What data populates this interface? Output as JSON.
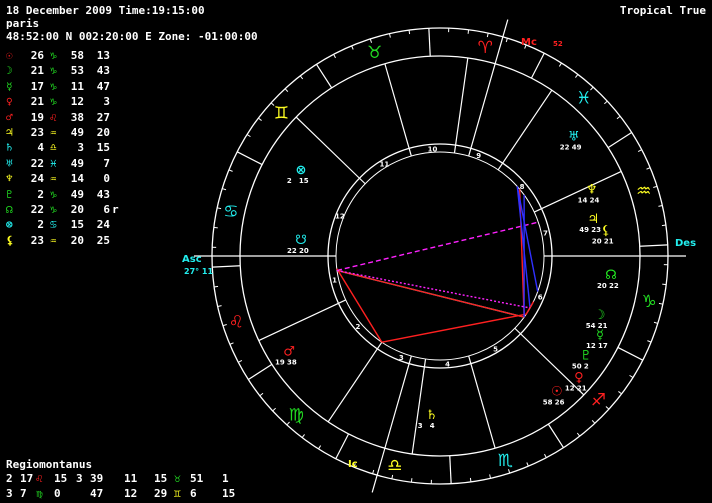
{
  "header": {
    "line1": "18 December 2009 Time:19:15:00",
    "line2": "paris",
    "line3": "48:52:00 N 002:20:00 E Zone: -01:00:00",
    "mode": "Tropical True"
  },
  "colors": {
    "fire": "#ff2020",
    "earth": "#22dd22",
    "air": "#ffff22",
    "water": "#22eeee",
    "node": "#22ee22",
    "magenta": "#ff22ff"
  },
  "planets": [
    {
      "glyph": "☉",
      "name": "sun-icon",
      "color": "#ff2020",
      "deg": "26",
      "sign": "♑",
      "scolor": "#22dd22",
      "min": "58",
      "sec": "13",
      "r": ""
    },
    {
      "glyph": "☽",
      "name": "moon-icon",
      "color": "#22dd22",
      "deg": "21",
      "sign": "♑",
      "scolor": "#22dd22",
      "min": "53",
      "sec": "43",
      "r": ""
    },
    {
      "glyph": "☿",
      "name": "mercury-icon",
      "color": "#22dd22",
      "deg": "17",
      "sign": "♑",
      "scolor": "#22dd22",
      "min": "11",
      "sec": "47",
      "r": ""
    },
    {
      "glyph": "♀",
      "name": "venus-icon",
      "color": "#ff2020",
      "deg": "21",
      "sign": "♑",
      "scolor": "#22dd22",
      "min": "12",
      "sec": "3",
      "r": ""
    },
    {
      "glyph": "♂",
      "name": "mars-icon",
      "color": "#ff2020",
      "deg": "19",
      "sign": "♌",
      "scolor": "#ff2020",
      "min": "38",
      "sec": "27",
      "r": ""
    },
    {
      "glyph": "♃",
      "name": "jupiter-icon",
      "color": "#ffff22",
      "deg": "23",
      "sign": "♒",
      "scolor": "#ffff22",
      "min": "49",
      "sec": "20",
      "r": ""
    },
    {
      "glyph": "♄",
      "name": "saturn-icon",
      "color": "#22eeee",
      "deg": "4",
      "sign": "♎",
      "scolor": "#ffff22",
      "min": "3",
      "sec": "15",
      "r": ""
    },
    {
      "glyph": "♅",
      "name": "uranus-icon",
      "color": "#22eeee",
      "deg": "22",
      "sign": "♓",
      "scolor": "#22eeee",
      "min": "49",
      "sec": "7",
      "r": ""
    },
    {
      "glyph": "♆",
      "name": "neptune-icon",
      "color": "#ffff22",
      "deg": "24",
      "sign": "♒",
      "scolor": "#ffff22",
      "min": "14",
      "sec": "0",
      "r": ""
    },
    {
      "glyph": "♇",
      "name": "pluto-icon",
      "color": "#22dd22",
      "deg": "2",
      "sign": "♑",
      "scolor": "#22dd22",
      "min": "49",
      "sec": "43",
      "r": ""
    },
    {
      "glyph": "☊",
      "name": "node-icon",
      "color": "#22ee22",
      "deg": "22",
      "sign": "♑",
      "scolor": "#22dd22",
      "min": "20",
      "sec": "6",
      "r": "r"
    },
    {
      "glyph": "⊗",
      "name": "part-of-fortune-icon",
      "color": "#22eeee",
      "deg": "2",
      "sign": "♋",
      "scolor": "#22eeee",
      "min": "15",
      "sec": "24",
      "r": ""
    },
    {
      "glyph": "⚸",
      "name": "lilith-icon",
      "color": "#ffff22",
      "deg": "23",
      "sign": "♒",
      "scolor": "#ffff22",
      "min": "20",
      "sec": "25",
      "r": ""
    }
  ],
  "houses": {
    "system": "Regiomontanus",
    "row1": [
      {
        "h": "2",
        "d": "17",
        "sign": "♌",
        "sc": "#ff2020",
        "m": "15"
      },
      {
        "h": "3",
        "d": "39",
        "sign": "",
        "sc": "",
        "m": "11"
      },
      {
        "h": "",
        "d": "15",
        "sign": "♉",
        "sc": "#22dd22",
        "m": "51"
      },
      {
        "h": "",
        "d": "1",
        "sign": "",
        "sc": "",
        "m": ""
      }
    ],
    "row2": [
      {
        "h": "3",
        "d": "7",
        "sign": "♍",
        "sc": "#22dd22",
        "m": "0"
      },
      {
        "h": "",
        "d": "47",
        "sign": "",
        "sc": "",
        "m": "12"
      },
      {
        "h": "",
        "d": "29",
        "sign": "♊",
        "sc": "#ffff22",
        "m": "6"
      },
      {
        "h": "",
        "d": "15",
        "sign": "",
        "sc": "",
        "m": ""
      }
    ]
  },
  "wheel": {
    "angles": {
      "asc": "Asc",
      "asc_deg": "27° 11",
      "des": "Des",
      "mc": "Mc",
      "mc_deg": "52",
      "ic": "Ic"
    },
    "zodiac": [
      {
        "glyph": "♈",
        "color": "#ff2020",
        "name": "aries-icon"
      },
      {
        "glyph": "♉",
        "color": "#22dd22",
        "name": "taurus-icon"
      },
      {
        "glyph": "♊",
        "color": "#ffff22",
        "name": "gemini-icon"
      },
      {
        "glyph": "♋",
        "color": "#22eeee",
        "name": "cancer-icon"
      },
      {
        "glyph": "♌",
        "color": "#ff2020",
        "name": "leo-icon"
      },
      {
        "glyph": "♍",
        "color": "#22dd22",
        "name": "virgo-icon"
      },
      {
        "glyph": "♎",
        "color": "#ffff22",
        "name": "libra-icon"
      },
      {
        "glyph": "♏",
        "color": "#22eeee",
        "name": "scorpio-icon"
      },
      {
        "glyph": "♐",
        "color": "#ff2020",
        "name": "sagittarius-icon"
      },
      {
        "glyph": "♑",
        "color": "#22dd22",
        "name": "capricorn-icon"
      },
      {
        "glyph": "♒",
        "color": "#ffff22",
        "name": "aquarius-icon"
      },
      {
        "glyph": "♓",
        "color": "#22eeee",
        "name": "pisces-icon"
      }
    ],
    "house_numbers": [
      "1",
      "2",
      "3",
      "4",
      "5",
      "6",
      "7",
      "8",
      "9",
      "10",
      "11",
      "12"
    ],
    "planet_labels": [
      {
        "glyph": "♅",
        "color": "#22eeee",
        "name": "uranus-chart-icon",
        "deg": "22",
        "min": "49"
      },
      {
        "glyph": "♆",
        "color": "#ffff22",
        "name": "neptune-chart-icon",
        "deg": "14",
        "min": "24"
      },
      {
        "glyph": "♃",
        "color": "#ffff22",
        "name": "jupiter-chart-icon",
        "deg": "49",
        "min": "23"
      },
      {
        "glyph": "⚸",
        "color": "#ffff22",
        "name": "lilith-chart-icon",
        "deg": "20",
        "min": "21"
      },
      {
        "glyph": "☊",
        "color": "#22ee22",
        "name": "node-chart-icon",
        "deg": "20",
        "min": "22"
      },
      {
        "glyph": "☽",
        "color": "#22dd22",
        "name": "moon-chart-icon",
        "deg": "54",
        "min": "21"
      },
      {
        "glyph": "☿",
        "color": "#22dd22",
        "name": "mercury-chart-icon",
        "deg": "12",
        "min": "17"
      },
      {
        "glyph": "♇",
        "color": "#22dd22",
        "name": "pluto-chart-icon",
        "deg": "50",
        "min": "2"
      },
      {
        "glyph": "♀",
        "color": "#ff2020",
        "name": "venus-chart-icon",
        "deg": "12",
        "min": "21"
      },
      {
        "glyph": "☉",
        "color": "#ff2020",
        "name": "sun-chart-icon",
        "deg": "58",
        "min": "26"
      },
      {
        "glyph": "♄",
        "color": "#ffff22",
        "name": "saturn-chart-icon",
        "deg": "3",
        "min": "4"
      },
      {
        "glyph": "♂",
        "color": "#ff2020",
        "name": "mars-chart-icon",
        "deg": "19",
        "min": "38"
      },
      {
        "glyph": "⊗",
        "color": "#22eeee",
        "name": "fortune-chart-icon",
        "deg": "2",
        "min": "15"
      },
      {
        "glyph": "☋",
        "color": "#22eeee",
        "name": "south-node-chart-icon",
        "deg": "22",
        "min": "20"
      }
    ]
  }
}
